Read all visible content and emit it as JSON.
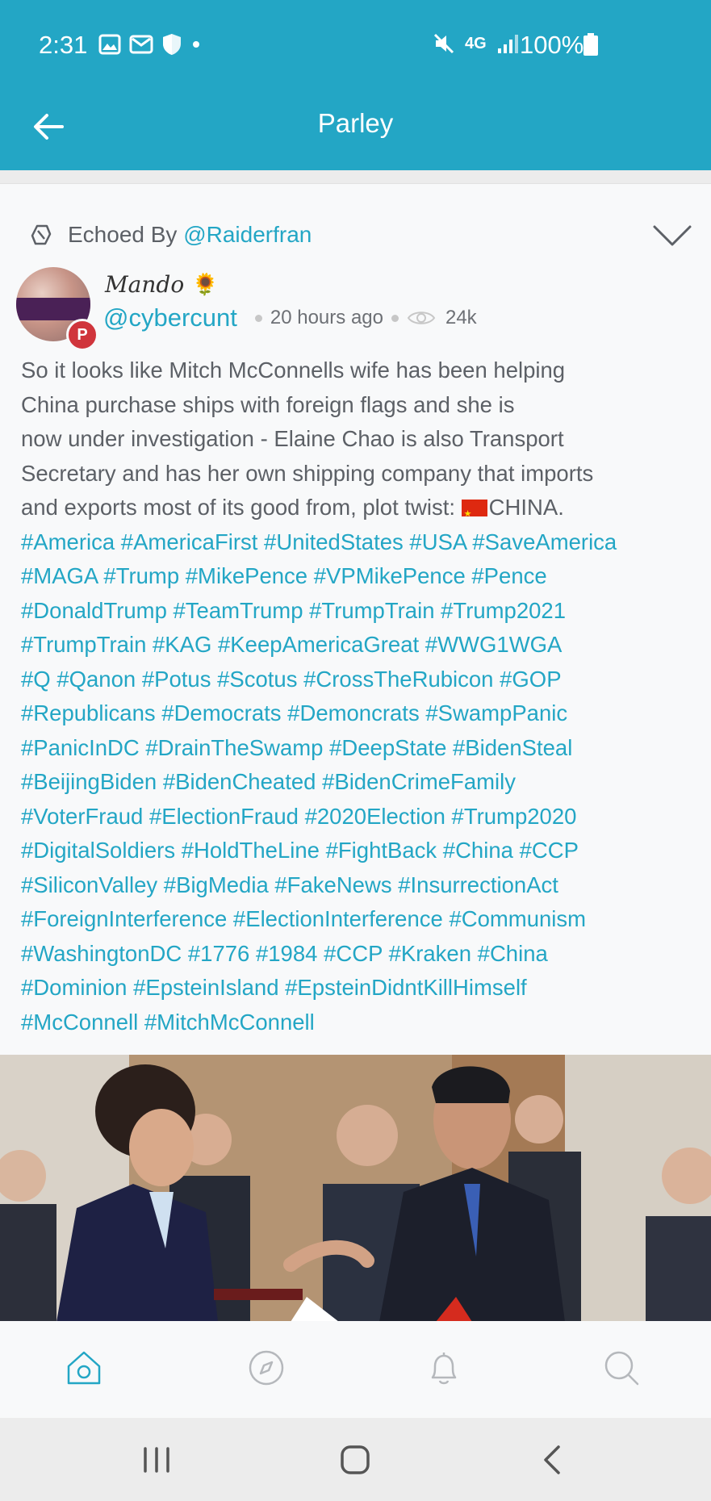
{
  "status_bar": {
    "time": "2:31",
    "network": "4G",
    "battery": "100%",
    "icons": [
      "image-icon",
      "mail-icon",
      "shield-icon",
      "dot-icon",
      "mute-icon",
      "network-icon",
      "signal-icon",
      "battery-icon"
    ]
  },
  "header": {
    "title": "Parley",
    "back_icon": "arrow-left-icon"
  },
  "post": {
    "echoed_prefix": "Echoed By",
    "echoed_handle": "@Raiderfran",
    "display_name": "Mando",
    "display_emoji": "🌻",
    "username": "@cybercunt",
    "time_ago": "20 hours ago",
    "views": "24k",
    "body_lines": [
      "So it looks like Mitch McConnells wife has been helping",
      "China purchase ships with foreign flags and she is",
      "now under investigation - Elaine Chao is also Transport",
      "Secretary and has her own shipping company that imports",
      "and exports most of its good from, plot twist: "
    ],
    "body_tail": "CHINA.",
    "hashtag_lines": [
      "#America #AmericaFirst #UnitedStates #USA #SaveAmerica",
      "#MAGA #Trump #MikePence #VPMikePence #Pence",
      "#DonaldTrump #TeamTrump #TrumpTrain #Trump2021",
      "#TrumpTrain #KAG #KeepAmericaGreat #WWG1WGA",
      "#Q #Qanon #Potus #Scotus #CrossTheRubicon #GOP",
      "#Republicans #Democrats #Demoncrats #SwampPanic",
      "#PanicInDC #DrainTheSwamp #DeepState #BidenSteal",
      "#BeijingBiden #BidenCheated #BidenCrimeFamily",
      "#VoterFraud #ElectionFraud #2020Election #Trump2020",
      "#DigitalSoldiers #HoldTheLine #FightBack #China #CCP",
      "#SiliconValley #BigMedia #FakeNews #InsurrectionAct",
      "#ForeignInterference #ElectionInterference #Communism",
      "#WashingtonDC #1776 #1984 #CCP #Kraken #China",
      "#Dominion #EpsteinIsland #EpsteinDidntKillHimself",
      "#McConnell #MitchMcConnell"
    ],
    "badge_letter": "P"
  },
  "tabs": [
    {
      "name": "home-tab",
      "icon": "home-icon",
      "active": true
    },
    {
      "name": "discover-tab",
      "icon": "compass-icon",
      "active": false
    },
    {
      "name": "notifications-tab",
      "icon": "bell-icon",
      "active": false
    },
    {
      "name": "search-tab",
      "icon": "search-icon",
      "active": false
    }
  ],
  "colors": {
    "accent": "#23a6c5",
    "text": "#5c6066",
    "badge": "#d0353c",
    "inactive_icon": "#b5b8bc"
  }
}
